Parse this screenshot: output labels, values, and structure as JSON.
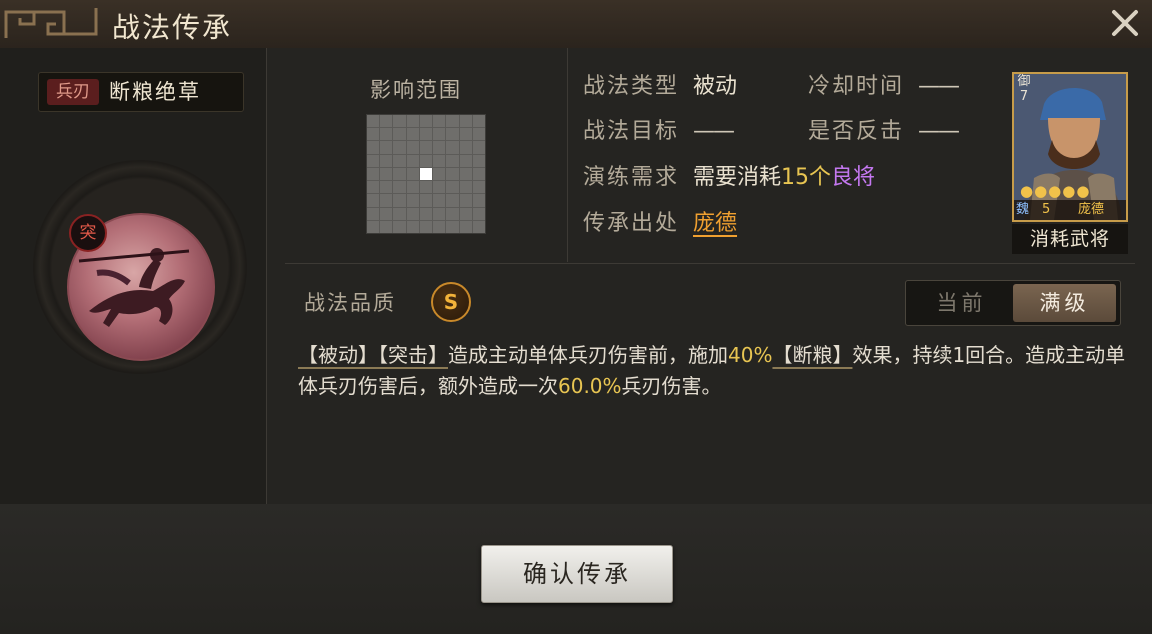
{
  "window": {
    "title": "战法传承"
  },
  "skill": {
    "type_tag": "兵刃",
    "name": "断粮绝草",
    "tu_badge": "突"
  },
  "range": {
    "label": "影响范围"
  },
  "info": {
    "type_label": "战法类型",
    "type_value": "被动",
    "cooldown_label": "冷却时间",
    "cooldown_value": "——",
    "target_label": "战法目标",
    "target_value": "——",
    "counter_label": "是否反击",
    "counter_value": "——",
    "practice_label": "演练需求",
    "practice_prefix": "需要消耗",
    "practice_count": "15个",
    "practice_item": "良将",
    "source_label": "传承出处",
    "source_value": "庞德"
  },
  "card": {
    "side_text": "御7",
    "stars": "●●●●●",
    "faction": "魏",
    "level": "5",
    "name": "庞德",
    "caption": "消耗武将"
  },
  "quality": {
    "label": "战法品质",
    "grade": "S"
  },
  "toggle": {
    "current": "当前",
    "full": "满级"
  },
  "description": {
    "t1": "【被动】",
    "t2": "【突击】",
    "t3": "造成主动单体兵刃伤害前，施加",
    "t4": "40%",
    "t5": "【断粮】",
    "t6": "效果，持续1回合。造成主动单体兵刃伤害后，额外造成一次",
    "t7": "60.0%",
    "t8": "兵刃伤害。"
  },
  "confirm_button": "确认传承",
  "colors": {
    "accent_gold": "#e8c552",
    "purple": "#c478f0",
    "orange": "#f0a030",
    "quality_ring": "#c9892a"
  }
}
